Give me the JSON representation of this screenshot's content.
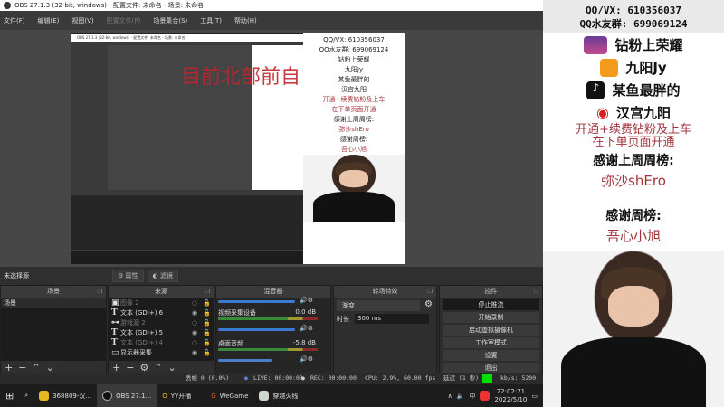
{
  "window": {
    "title": "OBS 27.1.3 (32-bit, windows) - 配置文件: 未命名 - 场景: 未命名"
  },
  "menu": [
    "文件(F)",
    "编辑(E)",
    "视图(V)",
    "配置文件(P)",
    "场景集合(S)",
    "工具(T)",
    "帮助(H)"
  ],
  "preview": {
    "overlay_text": "目前北部前自",
    "mini_qq": "QQ/VX: 610356037",
    "mini_group": "QQ水友群: 699069124"
  },
  "source_bar": {
    "no_source": "未选择源",
    "properties": "属性",
    "filters": "滤镜"
  },
  "scenes": {
    "header": "场景",
    "items": [
      "场景"
    ]
  },
  "sources": {
    "header": "来源",
    "items": [
      {
        "icon": "image-icon",
        "name": "图像 2",
        "visible": false
      },
      {
        "icon": "text-icon",
        "name": "文本 (GDI+) 6",
        "visible": true
      },
      {
        "icon": "gamepad-icon",
        "name": "游戏源 2",
        "visible": false
      },
      {
        "icon": "text-icon",
        "name": "文本 (GDI+) 5",
        "visible": true
      },
      {
        "icon": "text-icon",
        "name": "文本 (GDI+) 4",
        "visible": false
      },
      {
        "icon": "monitor-icon",
        "name": "显示器采集",
        "visible": true
      }
    ]
  },
  "mixer": {
    "header": "混音器",
    "channels": [
      {
        "name": "视频采集设备",
        "db": "0.0 dB",
        "level": 0.85
      },
      {
        "name": "桌面音频",
        "db": "-5.8 dB",
        "level": 0.6
      }
    ]
  },
  "transitions": {
    "header": "转场特效",
    "type": "渐变",
    "duration_label": "时长",
    "duration": "300 ms"
  },
  "controls": {
    "header": "控件",
    "buttons": [
      "停止推流",
      "开始录制",
      "启动虚拟摄像机",
      "工作室模式",
      "设置",
      "退出"
    ]
  },
  "status": {
    "dropped": "丢帧 0 (0.0%)",
    "live": "LIVE: 00:00:03",
    "rec": "REC: 00:00:00",
    "cpu": "CPU: 2.9%, 60.00 fps",
    "delay": "延迟 (1 秒)",
    "kbps": "kb/s: 5200",
    "health_color": "#00e000"
  },
  "taskbar": {
    "apps": [
      "368809-汉...",
      "OBS 27.1...",
      "YY开播",
      "WeGame",
      "穿越火线"
    ],
    "ime": "中",
    "time": "22:02:21",
    "date": "2022/5/10"
  },
  "overlay_panel": {
    "qq": "QQ/VX: 610356037",
    "group": "QQ水友群: 699069124",
    "rows": [
      {
        "icon": "diamond-badge-icon",
        "text": "钻粉上荣耀"
      },
      {
        "icon": "yy-app-icon",
        "text": "九阳Jy"
      },
      {
        "icon": "douyin-icon",
        "text": "某鱼最胖的"
      },
      {
        "icon": "weibo-icon",
        "text": "汉宫九阳"
      }
    ],
    "notice_1": "开通+续费钻粉及上车",
    "notice_2": "在下单页面开通",
    "last_week_label": "感谢上周周榜:",
    "last_week_name": "弥沙shEro",
    "this_week_label": "感谢周榜:",
    "this_week_name": "吾心小旭"
  }
}
